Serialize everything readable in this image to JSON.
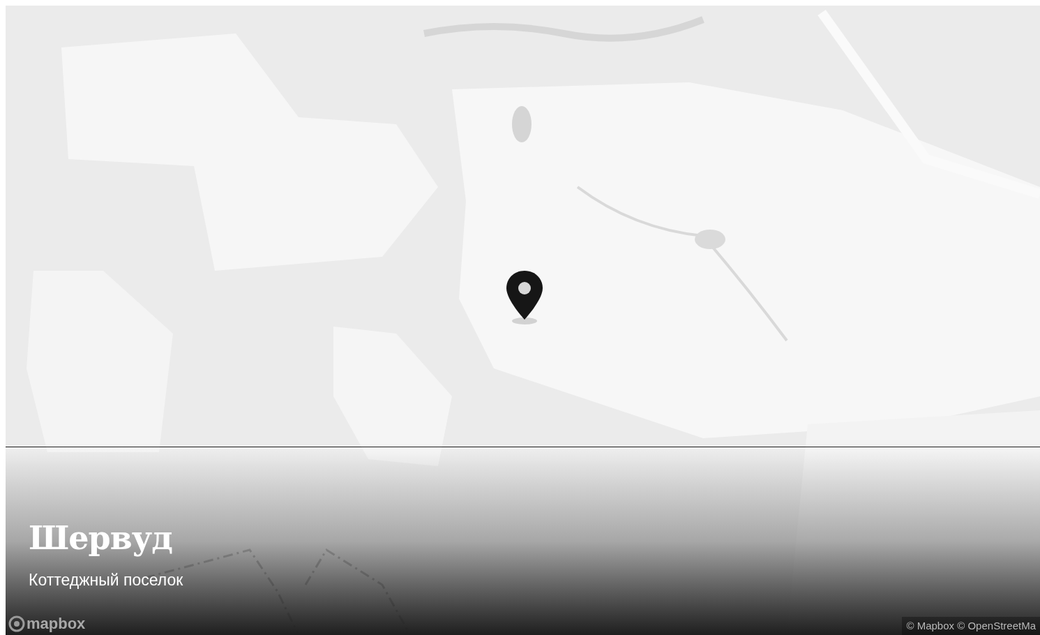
{
  "map": {
    "marker": {
      "kind": "pin"
    },
    "logo": "mapbox",
    "attribution": "© Mapbox © OpenStreetMa"
  },
  "card": {
    "title": "Шервуд",
    "subtitle": "Коттеджный поселок"
  }
}
